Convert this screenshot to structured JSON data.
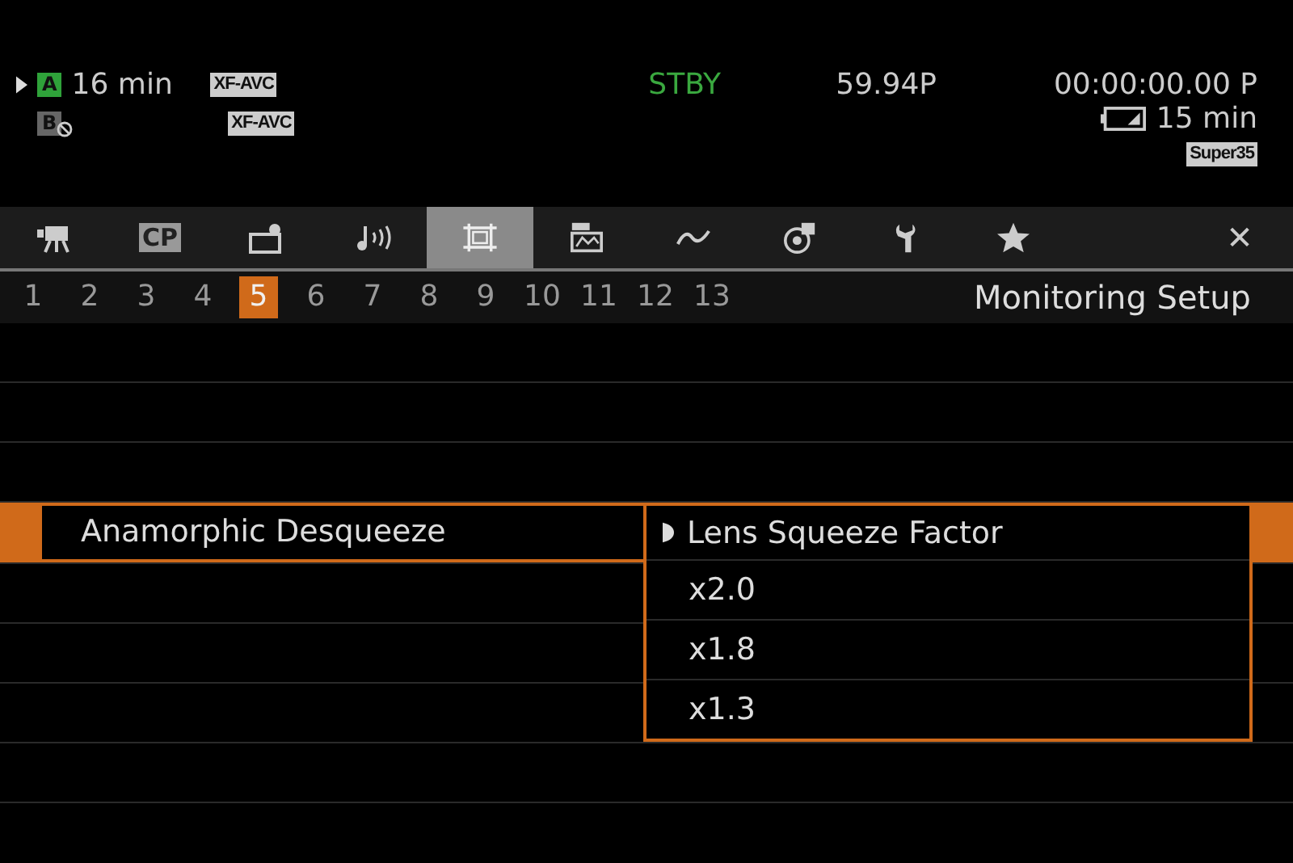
{
  "status": {
    "slot_a": {
      "letter": "A",
      "time": "16 min",
      "codec": "XF-AVC"
    },
    "slot_b": {
      "letter": "B",
      "codec": "XF-AVC"
    },
    "mode": "STBY",
    "frame_rate": "59.94P",
    "timecode": "00:00:00.00 P",
    "battery": "15 min",
    "sensor": "Super35"
  },
  "tabs": [
    {
      "kind": "camera",
      "selected": false
    },
    {
      "kind": "cp",
      "label": "CP",
      "selected": false
    },
    {
      "kind": "recording",
      "selected": false
    },
    {
      "kind": "audio",
      "selected": false
    },
    {
      "kind": "monitor",
      "selected": true
    },
    {
      "kind": "display",
      "selected": false
    },
    {
      "kind": "wave",
      "selected": false
    },
    {
      "kind": "media",
      "selected": false
    },
    {
      "kind": "wrench",
      "selected": false
    },
    {
      "kind": "star",
      "selected": false
    },
    {
      "kind": "close",
      "label": "✕",
      "selected": false
    }
  ],
  "pages": [
    {
      "label": "1",
      "selected": false
    },
    {
      "label": "2",
      "selected": false
    },
    {
      "label": "3",
      "selected": false
    },
    {
      "label": "4",
      "selected": false
    },
    {
      "label": "5",
      "selected": true
    },
    {
      "label": "6",
      "selected": false
    },
    {
      "label": "7",
      "selected": false
    },
    {
      "label": "8",
      "selected": false
    },
    {
      "label": "9",
      "selected": false
    },
    {
      "label": "10",
      "selected": false
    },
    {
      "label": "11",
      "selected": false
    },
    {
      "label": "12",
      "selected": false
    },
    {
      "label": "13",
      "selected": false
    }
  ],
  "page_title": "Monitoring Setup",
  "menu_item": {
    "label": "Anamorphic Desqueeze",
    "selected": true
  },
  "dropdown": {
    "title": "Lens Squeeze Factor",
    "options": [
      {
        "label": "x2.0",
        "selected": false
      },
      {
        "label": "x1.8",
        "selected": false
      },
      {
        "label": "x1.3",
        "selected": false
      }
    ]
  }
}
